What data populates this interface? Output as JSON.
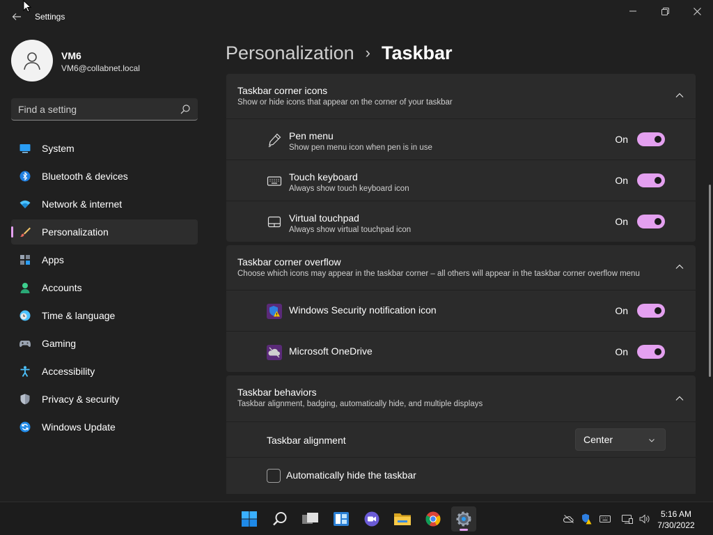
{
  "window": {
    "title": "Settings",
    "minimize_symbol": "—",
    "maximize_symbol": "⧉",
    "close_symbol": "✕"
  },
  "user": {
    "name": "VM6",
    "email": "VM6@collabnet.local"
  },
  "search": {
    "placeholder": "Find a setting"
  },
  "sidebar": {
    "items": [
      {
        "label": "System",
        "icon": "system-icon"
      },
      {
        "label": "Bluetooth & devices",
        "icon": "bluetooth-icon"
      },
      {
        "label": "Network & internet",
        "icon": "wifi-icon"
      },
      {
        "label": "Personalization",
        "icon": "brush-icon",
        "active": true
      },
      {
        "label": "Apps",
        "icon": "apps-icon"
      },
      {
        "label": "Accounts",
        "icon": "accounts-icon"
      },
      {
        "label": "Time & language",
        "icon": "clock-globe-icon"
      },
      {
        "label": "Gaming",
        "icon": "gamepad-icon"
      },
      {
        "label": "Accessibility",
        "icon": "accessibility-icon"
      },
      {
        "label": "Privacy & security",
        "icon": "shield-icon"
      },
      {
        "label": "Windows Update",
        "icon": "update-icon"
      }
    ]
  },
  "breadcrumb": {
    "parent": "Personalization",
    "separator": "›",
    "current": "Taskbar"
  },
  "sections": {
    "corner_icons": {
      "title": "Taskbar corner icons",
      "description": "Show or hide icons that appear on the corner of your taskbar",
      "rows": [
        {
          "title": "Pen menu",
          "description": "Show pen menu icon when pen is in use",
          "state": "On",
          "icon": "pen-icon"
        },
        {
          "title": "Touch keyboard",
          "description": "Always show touch keyboard icon",
          "state": "On",
          "icon": "keyboard-icon"
        },
        {
          "title": "Virtual touchpad",
          "description": "Always show virtual touchpad icon",
          "state": "On",
          "icon": "touchpad-icon"
        }
      ]
    },
    "corner_overflow": {
      "title": "Taskbar corner overflow",
      "description": "Choose which icons may appear in the taskbar corner – all others will appear in the taskbar corner overflow menu",
      "rows": [
        {
          "title": "Windows Security notification icon",
          "state": "On",
          "icon": "windows-security-icon"
        },
        {
          "title": "Microsoft OneDrive",
          "state": "On",
          "icon": "onedrive-icon"
        }
      ]
    },
    "behaviors": {
      "title": "Taskbar behaviors",
      "description": "Taskbar alignment, badging, automatically hide, and multiple displays",
      "alignment_label": "Taskbar alignment",
      "alignment_value": "Center",
      "autohide_label": "Automatically hide the taskbar"
    }
  },
  "taskbar": {
    "time": "5:16 AM",
    "date": "7/30/2022"
  },
  "colors": {
    "accent": "#e4a0f0",
    "background": "#202020",
    "card": "#2b2b2b"
  }
}
